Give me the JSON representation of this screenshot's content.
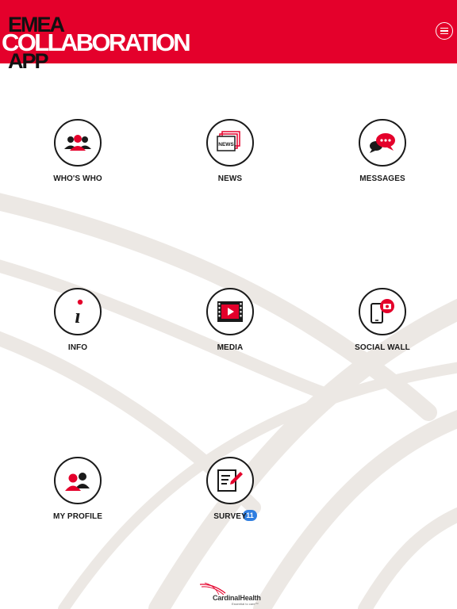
{
  "header": {
    "logo_line1": "EMEA",
    "logo_line2": "COLLABORATION",
    "logo_line3": "APP",
    "brand_color": "#e4002b",
    "menu_icon": "hamburger-menu-icon"
  },
  "tiles": [
    {
      "label": "WHO'S WHO",
      "icon": "people-group-icon"
    },
    {
      "label": "NEWS",
      "icon": "news-icon"
    },
    {
      "label": "MESSAGES",
      "icon": "chat-bubbles-icon"
    },
    {
      "label": "INFO",
      "icon": "info-icon"
    },
    {
      "label": "MEDIA",
      "icon": "video-play-icon"
    },
    {
      "label": "SOCIAL WALL",
      "icon": "phone-camera-icon"
    },
    {
      "label": "MY PROFILE",
      "icon": "profile-pair-icon"
    },
    {
      "label": "SURVEY",
      "icon": "survey-pen-icon",
      "badge": "11"
    }
  ],
  "footer": {
    "brand": "CardinalHealth",
    "tagline": "Essential to care™",
    "icon": "cardinal-health-logo-icon"
  }
}
